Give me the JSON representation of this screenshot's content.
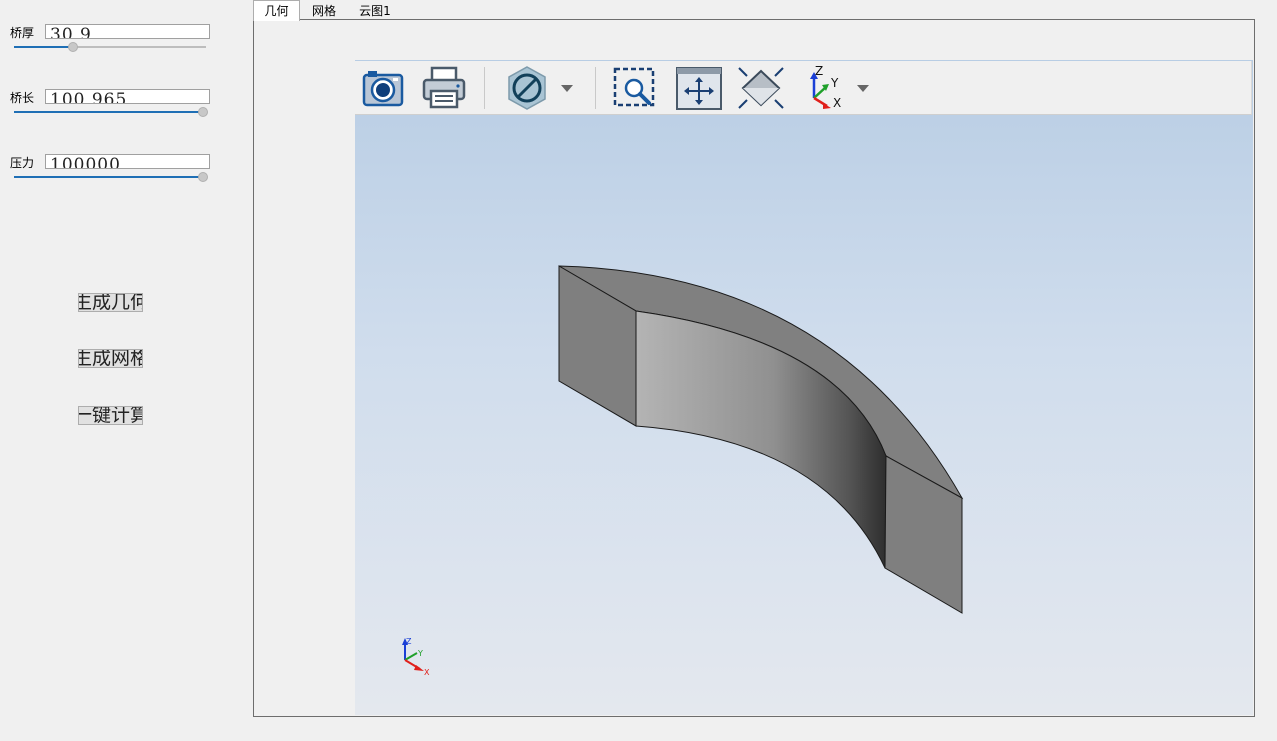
{
  "left_panel": {
    "params": [
      {
        "label": "桥厚",
        "value": "30  9",
        "slider_fraction": 0.3
      },
      {
        "label": "桥长",
        "value": "100  965",
        "slider_fraction": 1.0
      },
      {
        "label": "压力",
        "value": "100000",
        "slider_fraction": 1.0
      }
    ],
    "buttons": [
      {
        "label": "生成几何"
      },
      {
        "label": "生成网格"
      },
      {
        "label": "一键计算"
      }
    ]
  },
  "tabs": [
    {
      "label": "几何",
      "active": true
    },
    {
      "label": "网格",
      "active": false
    },
    {
      "label": "云图1",
      "active": false
    }
  ],
  "toolbar": {
    "items": [
      "camera-icon",
      "print-icon",
      "hide-icon",
      "dropdown-arrow-icon",
      "zoom-area-icon",
      "fit-all-icon",
      "reset-view-icon",
      "axes-orientation-icon",
      "dropdown-arrow-icon"
    ],
    "axes_labels": {
      "z": "Z",
      "y": "Y",
      "x": "X"
    }
  },
  "viewport": {
    "triad_labels": {
      "z": "Z",
      "y": "Y",
      "x": "X"
    }
  },
  "colors": {
    "slider_fill": "#1f6fb5",
    "accent_blue": "#1a5aa0",
    "axis_x": "#e0201b",
    "axis_y": "#1fa02a",
    "axis_z": "#1b3fd6"
  }
}
